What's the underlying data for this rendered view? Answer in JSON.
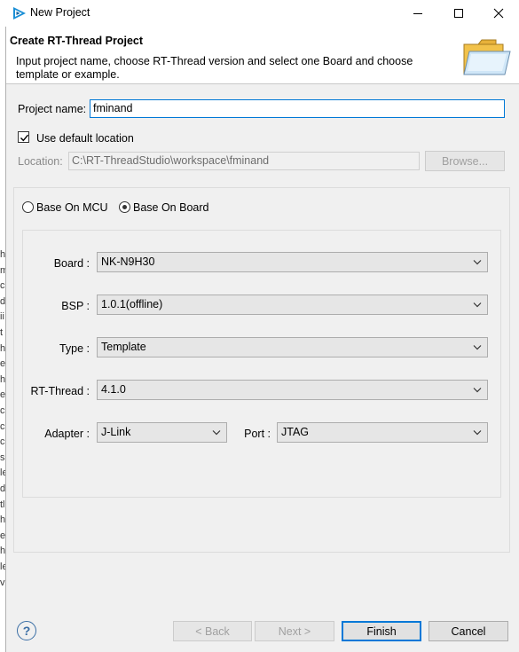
{
  "window": {
    "title": "New Project",
    "icon": "rt-thread-app-icon"
  },
  "header": {
    "title": "Create RT-Thread Project",
    "description": "Input project name, choose RT-Thread version and select one Board and choose template or example.",
    "icon": "folder-icon"
  },
  "form": {
    "project_name_label": "Project name:",
    "project_name_value": "fminand",
    "use_default_label": "Use default location",
    "use_default_checked": true,
    "location_label": "Location:",
    "location_value": "C:\\RT-ThreadStudio\\workspace\\fminand",
    "browse_label": "Browse..."
  },
  "base": {
    "mcu_label": "Base On MCU",
    "board_label": "Base On Board",
    "selected": "board"
  },
  "options": {
    "board_label": "Board :",
    "board_value": "NK-N9H30",
    "bsp_label": "BSP :",
    "bsp_value": "1.0.1(offline)",
    "type_label": "Type :",
    "type_value": "Template",
    "rtthread_label": "RT-Thread :",
    "rtthread_value": "4.1.0",
    "adapter_label": "Adapter :",
    "adapter_value": "J-Link",
    "port_label": "Port :",
    "port_value": "JTAG"
  },
  "buttons": {
    "back": "< Back",
    "next": "Next >",
    "finish": "Finish",
    "cancel": "Cancel",
    "help": "?"
  },
  "left_strip": [
    "h",
    "m",
    "c",
    "d",
    "ii",
    "t",
    "h",
    "e",
    "h",
    "e",
    "c",
    "c",
    "c",
    "s",
    "le",
    "d",
    "tl",
    "h",
    "e",
    "h",
    "le",
    "v"
  ],
  "colors": {
    "accent": "#0078d7",
    "window_bg": "#f0f0f0",
    "header_bg": "#ffffff"
  }
}
